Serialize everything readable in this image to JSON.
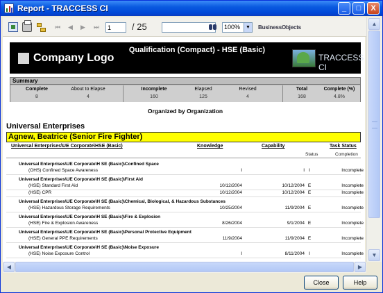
{
  "window": {
    "title": "Report - TRACCESS CI",
    "min": "_",
    "max": "□",
    "close": "X"
  },
  "toolbar": {
    "nav_first": "⏮",
    "nav_prev": "◀",
    "nav_next": "▶",
    "nav_last": "⏭",
    "page_value": "1",
    "page_total": "/ 25",
    "search_value": "",
    "zoom_value": "100%",
    "brand": "BusinessObjects"
  },
  "report": {
    "company_logo": "Company Logo",
    "title": "Qualification (Compact) - HSE (Basic)",
    "traccess": "TRACCESS CI",
    "summary": {
      "label": "Summary",
      "columns": [
        "Complete",
        "About to Elapse",
        "Incomplete",
        "Elapsed",
        "Revised",
        "Total",
        "Complete (%)"
      ],
      "values": [
        "8",
        "4",
        "160",
        "125",
        "4",
        "168",
        "4.8%"
      ]
    },
    "organized_by": "Organized by Organization",
    "org": "Universal Enterprises",
    "person": "Agnew, Beatrice (Senior Fire Fighter)",
    "col_path": "Universal Enterprises\\UE Corporate\\HSE (Basic)",
    "col_knowledge": "Knowledge",
    "col_capability": "Capability",
    "col_task_status": "Task Status",
    "sub_status": "Status",
    "sub_completion": "Completion",
    "groups": [
      {
        "title": "Universal Enterprises\\UE Corporate\\H SE (Basic)\\Confined Space",
        "rows": [
          {
            "name": "(OHS) Confined Space Awareness",
            "knowledge": "I",
            "capability": "I",
            "status": "I",
            "completion": "Incomplete"
          }
        ]
      },
      {
        "title": "Universal Enterprises\\UE Corporate\\H SE (Basic)\\First Aid",
        "rows": [
          {
            "name": "(HSE) Standard First Aid",
            "knowledge": "10/12/2004",
            "capability": "10/12/2004",
            "status": "E",
            "completion": "Incomplete"
          },
          {
            "name": "(HSE) CPR",
            "knowledge": "10/12/2004",
            "capability": "10/12/2004",
            "status": "E",
            "completion": "Incomplete"
          }
        ]
      },
      {
        "title": "Universal Enterprises\\UE Corporate\\H SE (Basic)\\Chemical, Biological, & Hazardous Substances",
        "rows": [
          {
            "name": "(HSE) Hazardous Storage Requirements",
            "knowledge": "10/25/2004",
            "capability": "11/9/2004",
            "status": "E",
            "completion": "Incomplete"
          }
        ]
      },
      {
        "title": "Universal Enterprises\\UE Corporate\\H SE (Basic)\\Fire & Explosion",
        "rows": [
          {
            "name": "(HSE) Fire & Explosion Awareness",
            "knowledge": "8/26/2004",
            "capability": "9/1/2004",
            "status": "E",
            "completion": "Incomplete"
          }
        ]
      },
      {
        "title": "Universal Enterprises\\UE Corporate\\H SE (Basic)\\Personal Protective Equipment",
        "rows": [
          {
            "name": "(HSE) General PPE Requirements",
            "knowledge": "11/9/2004",
            "capability": "11/9/2004",
            "status": "E",
            "completion": "Incomplete"
          }
        ]
      },
      {
        "title": "Universal Enterprises\\UE Corporate\\H SE (Basic)\\Noise Exposure",
        "rows": [
          {
            "name": "(HSE) Noise Exposure Control",
            "knowledge": "I",
            "capability": "8/11/2004",
            "status": "I",
            "completion": "Incomplete"
          }
        ]
      }
    ]
  },
  "scroll": {
    "up": "▲",
    "down": "▼",
    "left": "◀",
    "right": "▶"
  },
  "buttons": {
    "close": "Close",
    "help": "Help"
  }
}
